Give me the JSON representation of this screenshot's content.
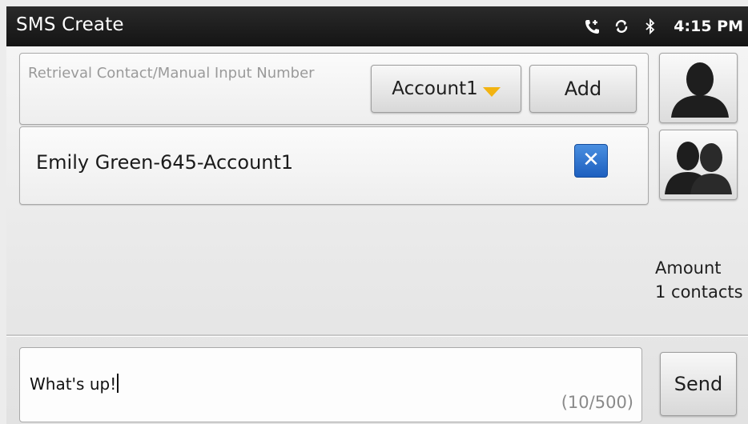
{
  "titlebar": {
    "title": "SMS Create",
    "time": "4:15 PM",
    "status_icons": [
      "call-forward-icon",
      "sync-icon",
      "bluetooth-icon"
    ]
  },
  "recipient_search": {
    "placeholder": "Retrieval Contact/Manual Input Number",
    "account_select": "Account1",
    "add_label": "Add"
  },
  "recipients": [
    {
      "label": "Emily Green-645-Account1",
      "remove_icon": "close-icon"
    }
  ],
  "side_buttons": {
    "single_contact_icon": "person-icon",
    "group_contact_icon": "group-icon"
  },
  "amount": {
    "label": "Amount",
    "value": "1 contacts"
  },
  "message": {
    "text": "What's up!",
    "counter": "(10/500)"
  },
  "send_label": "Send",
  "colors": {
    "titlebar_bg": "#1c1c1c",
    "accent_blue": "#1d5fbf",
    "caret_yellow": "#f2b311"
  }
}
